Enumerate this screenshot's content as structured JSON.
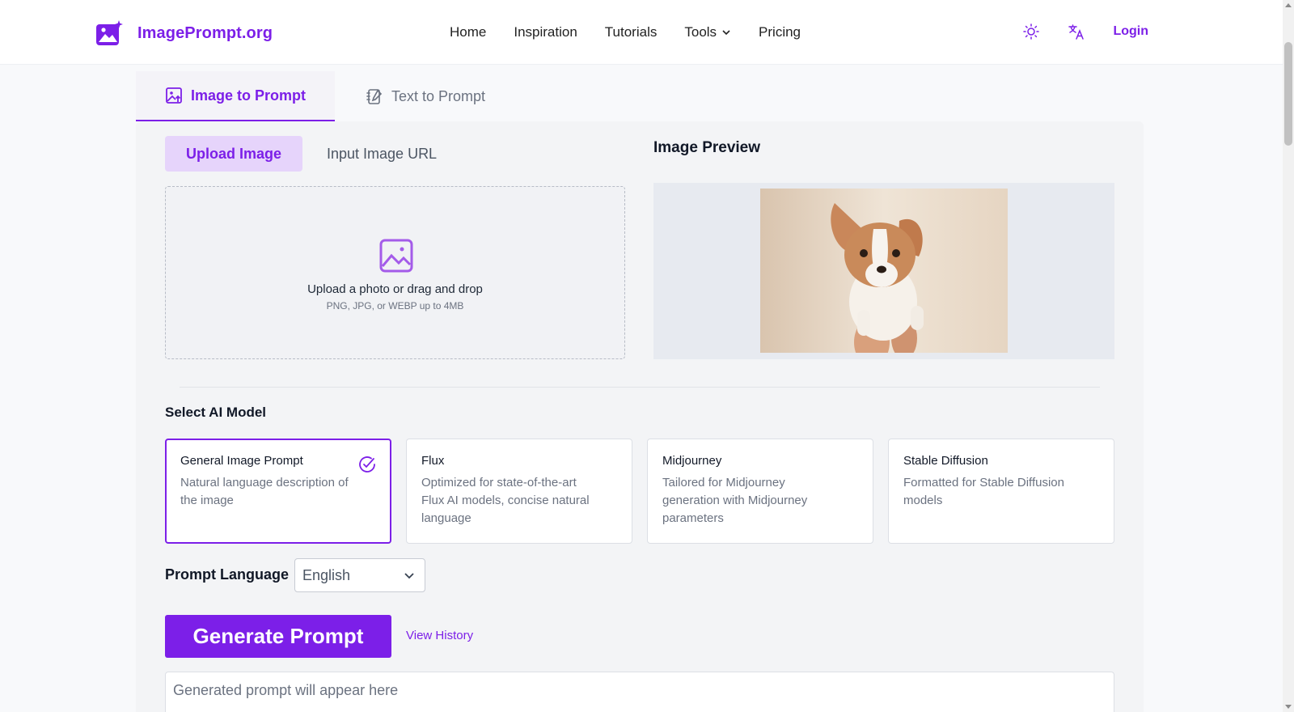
{
  "header": {
    "logo_text": "ImagePrompt.org",
    "nav": [
      "Home",
      "Inspiration",
      "Tutorials",
      "Tools",
      "Pricing"
    ],
    "login": "Login"
  },
  "tabs": {
    "image_to_prompt": "Image to Prompt",
    "text_to_prompt": "Text to Prompt"
  },
  "upload": {
    "tab_upload": "Upload Image",
    "tab_url": "Input Image URL",
    "dropzone_text": "Upload a photo or drag and drop",
    "dropzone_sub": "PNG, JPG, or WEBP up to 4MB"
  },
  "preview": {
    "title": "Image Preview"
  },
  "model_section": {
    "label": "Select AI Model",
    "models": [
      {
        "title": "General Image Prompt",
        "desc": "Natural language description of the image",
        "selected": true
      },
      {
        "title": "Flux",
        "desc": "Optimized for state-of-the-art Flux AI models, concise natural language",
        "selected": false
      },
      {
        "title": "Midjourney",
        "desc": "Tailored for Midjourney generation with Midjourney parameters",
        "selected": false
      },
      {
        "title": "Stable Diffusion",
        "desc": "Formatted for Stable Diffusion models",
        "selected": false
      }
    ]
  },
  "language": {
    "label": "Prompt Language",
    "selected": "English"
  },
  "actions": {
    "generate": "Generate Prompt",
    "history": "View History"
  },
  "output": {
    "placeholder": "Generated prompt will appear here"
  },
  "colors": {
    "accent": "#7c1fe8",
    "accent_light": "#e6d4fb"
  }
}
